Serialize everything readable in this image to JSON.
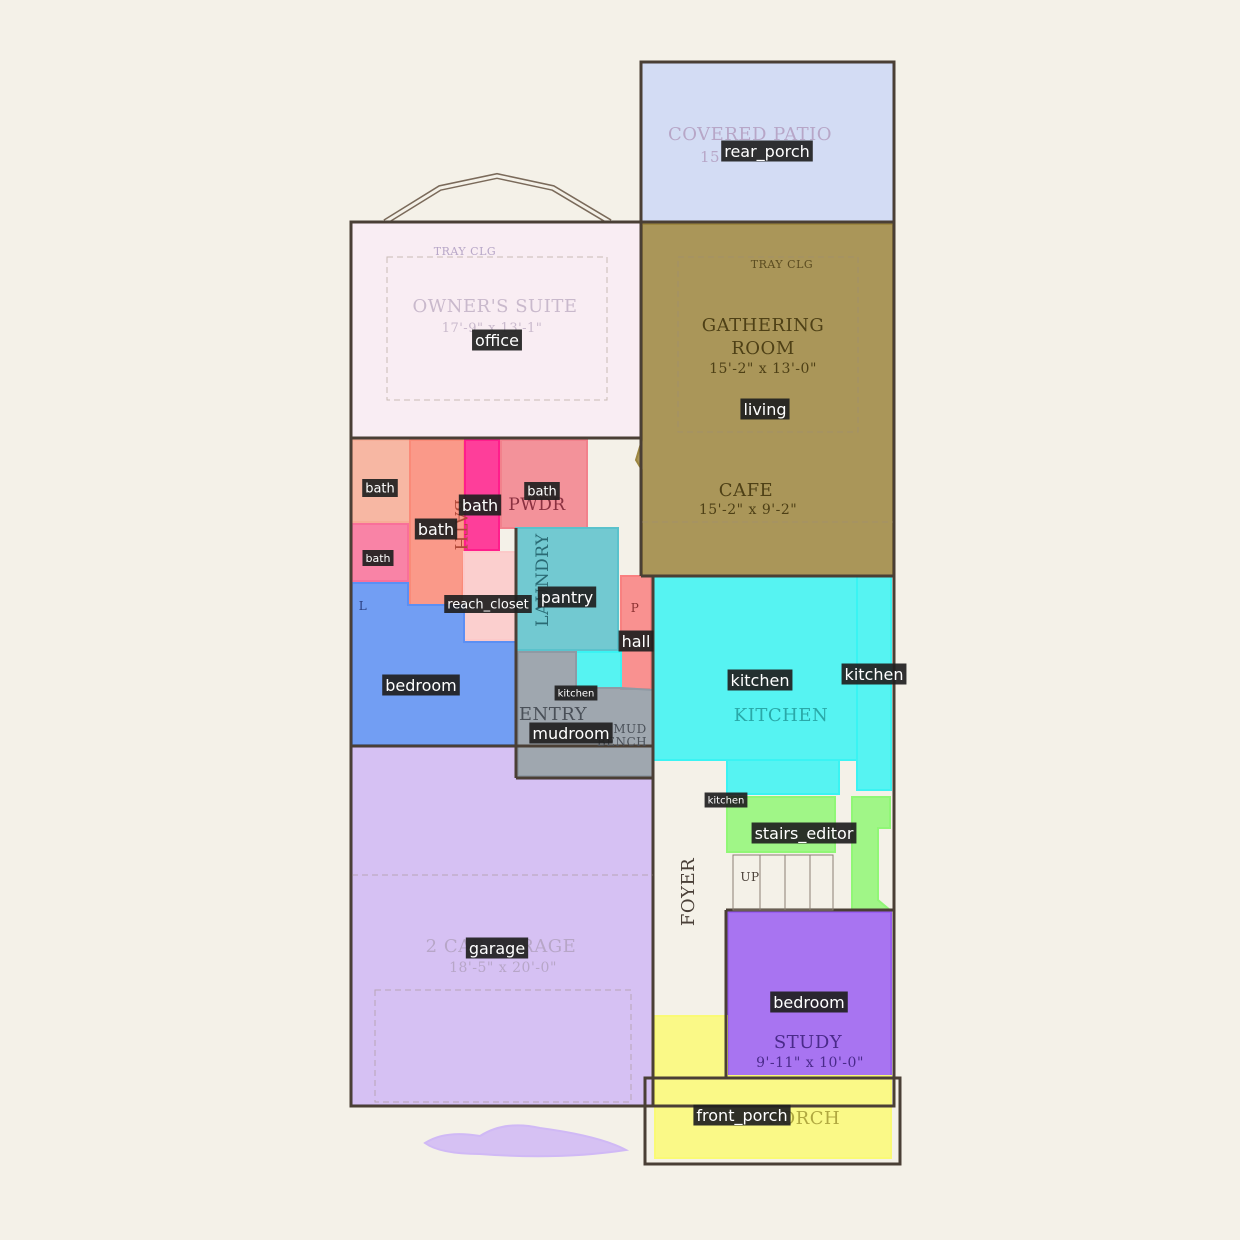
{
  "printed_labels": {
    "covered_patio": "COVERED PATIO",
    "covered_patio_dim": "15",
    "tray_clg_1": "TRAY CLG",
    "tray_clg_2": "TRAY CLG",
    "owners_suite": "OWNER'S SUITE",
    "owners_suite_dim": "17'-9\" x 13'-1\"",
    "gathering_room_1": "GATHERING",
    "gathering_room_2": "ROOM",
    "gathering_room_dim": "15'-2\" x 13'-0\"",
    "cafe": "CAFE",
    "cafe_dim": "15'-2\" x 9'-2\"",
    "pwdr": "PWDR",
    "bath_vertical": "BATH",
    "laundry": "LAUNDRY",
    "p": "P",
    "l": "L",
    "entry": "ENTRY",
    "mud_bench_1": "MUD",
    "mud_bench_2": "BENCH",
    "kitchen": "KITCHEN",
    "foyer": "FOYER",
    "up": "UP",
    "garage": "2 CAR GARAGE",
    "garage_dim": "18'-5\" x 20'-0\"",
    "study": "STUDY",
    "study_dim": "9'-11\" x 10'-0\"",
    "porch": "PORCH"
  },
  "regions": [
    {
      "tag": "rear_porch",
      "color": "#cdd8f6"
    },
    {
      "tag": "office",
      "color": "#f9ecf5"
    },
    {
      "tag": "living",
      "color": "#9c8640"
    },
    {
      "tag": "bath",
      "color": "#f7ad97"
    },
    {
      "tag": "bath",
      "color": "#fa8a78"
    },
    {
      "tag": "bath",
      "color": "#f9709a"
    },
    {
      "tag": "bath",
      "color": "#ff1e8c"
    },
    {
      "tag": "bath",
      "color": "#f2818c"
    },
    {
      "tag": "reach_closet",
      "color": "#fcc9c9"
    },
    {
      "tag": "pantry",
      "color": "#5ac2cc"
    },
    {
      "tag": "hall",
      "color": "#f98080"
    },
    {
      "tag": "bedroom",
      "color": "#5b8ff4"
    },
    {
      "tag": "kitchen",
      "color": "#3af3f3"
    },
    {
      "tag": "kitchen",
      "color": "#3af3f3"
    },
    {
      "tag": "kitchen",
      "color": "#3af3f3"
    },
    {
      "tag": "kitchen",
      "color": "#3af3f3"
    },
    {
      "tag": "mudroom",
      "color": "#8f9aa4"
    },
    {
      "tag": "stairs_editor",
      "color": "#90f776"
    },
    {
      "tag": "garage",
      "color": "#d0b9f5"
    },
    {
      "tag": "bedroom",
      "color": "#9a5ef2"
    },
    {
      "tag": "front_porch",
      "color": "#fafa75"
    }
  ]
}
